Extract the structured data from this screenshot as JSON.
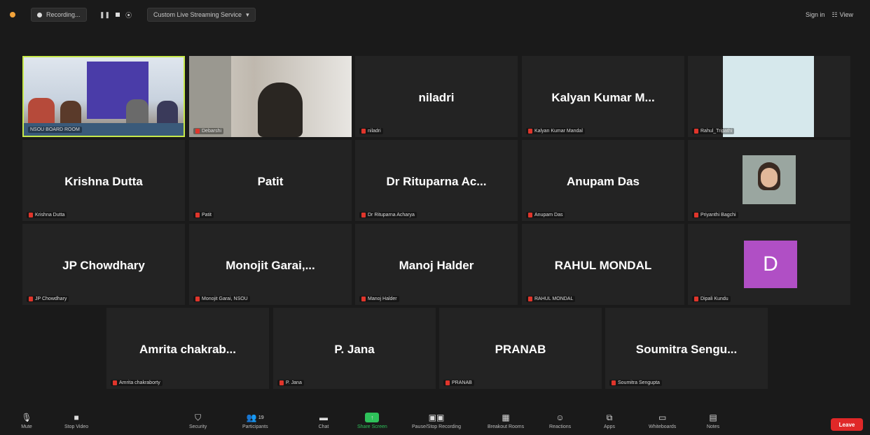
{
  "topbar": {
    "recording_label": "Recording...",
    "stream_label": "Custom Live Streaming Service",
    "sign_in": "Sign in",
    "view_label": "View"
  },
  "tiles": [
    {
      "display": "",
      "label": "NSOU BOARD ROOM",
      "kind": "video-room",
      "muted": false,
      "active": true
    },
    {
      "display": "",
      "label": "Debarshi",
      "kind": "video-person",
      "muted": true
    },
    {
      "display": "niladri",
      "label": "niladri",
      "muted": true
    },
    {
      "display": "Kalyan Kumar M...",
      "label": "Kalyan Kumar Mandal",
      "muted": true
    },
    {
      "display": "",
      "label": "Rahul_Tripathi",
      "kind": "video-blank",
      "muted": true
    },
    {
      "display": "Krishna Dutta",
      "label": "Krishna Dutta",
      "muted": true
    },
    {
      "display": "Patit",
      "label": "Patit",
      "muted": true
    },
    {
      "display": "Dr Rituparna Ac...",
      "label": "Dr Rituparna Acharya",
      "muted": true
    },
    {
      "display": "Anupam Das",
      "label": "Anupam Das",
      "muted": true
    },
    {
      "display": "",
      "label": "Priyanthi Bagchi",
      "kind": "video-photo",
      "muted": true
    },
    {
      "display": "JP Chowdhary",
      "label": "JP Chowdhary",
      "muted": true
    },
    {
      "display": "Monojit Garai,...",
      "label": "Monojit Garai, NSOU",
      "muted": true
    },
    {
      "display": "Manoj Halder",
      "label": "Manoj Halder",
      "muted": true
    },
    {
      "display": "RAHUL MONDAL",
      "label": "RAHUL MONDAL",
      "muted": true
    },
    {
      "display": "",
      "label": "Dipali Kundu",
      "kind": "avatar",
      "avatar_letter": "D",
      "avatar_color": "#b04fc5",
      "muted": true
    },
    {
      "display": "Amrita chakrab...",
      "label": "Amrita chakraborty",
      "muted": true
    },
    {
      "display": "P. Jana",
      "label": "P. Jana",
      "muted": true
    },
    {
      "display": "PRANAB",
      "label": "PRANAB",
      "muted": true
    },
    {
      "display": "Soumitra Sengu...",
      "label": "Soumitra Sengupta",
      "muted": true
    }
  ],
  "toolbar": {
    "mute": "Mute",
    "stop_video": "Stop Video",
    "security": "Security",
    "participants": "Participants",
    "participants_count": "19",
    "chat": "Chat",
    "share_screen": "Share Screen",
    "pause_recording": "Pause/Stop Recording",
    "breakout_rooms": "Breakout Rooms",
    "reactions": "Reactions",
    "apps": "Apps",
    "whiteboards": "Whiteboards",
    "notes": "Notes",
    "leave": "Leave"
  },
  "colors": {
    "accent_green": "#2ec15a",
    "leave_red": "#e02828",
    "active_border": "#c6e84a"
  }
}
